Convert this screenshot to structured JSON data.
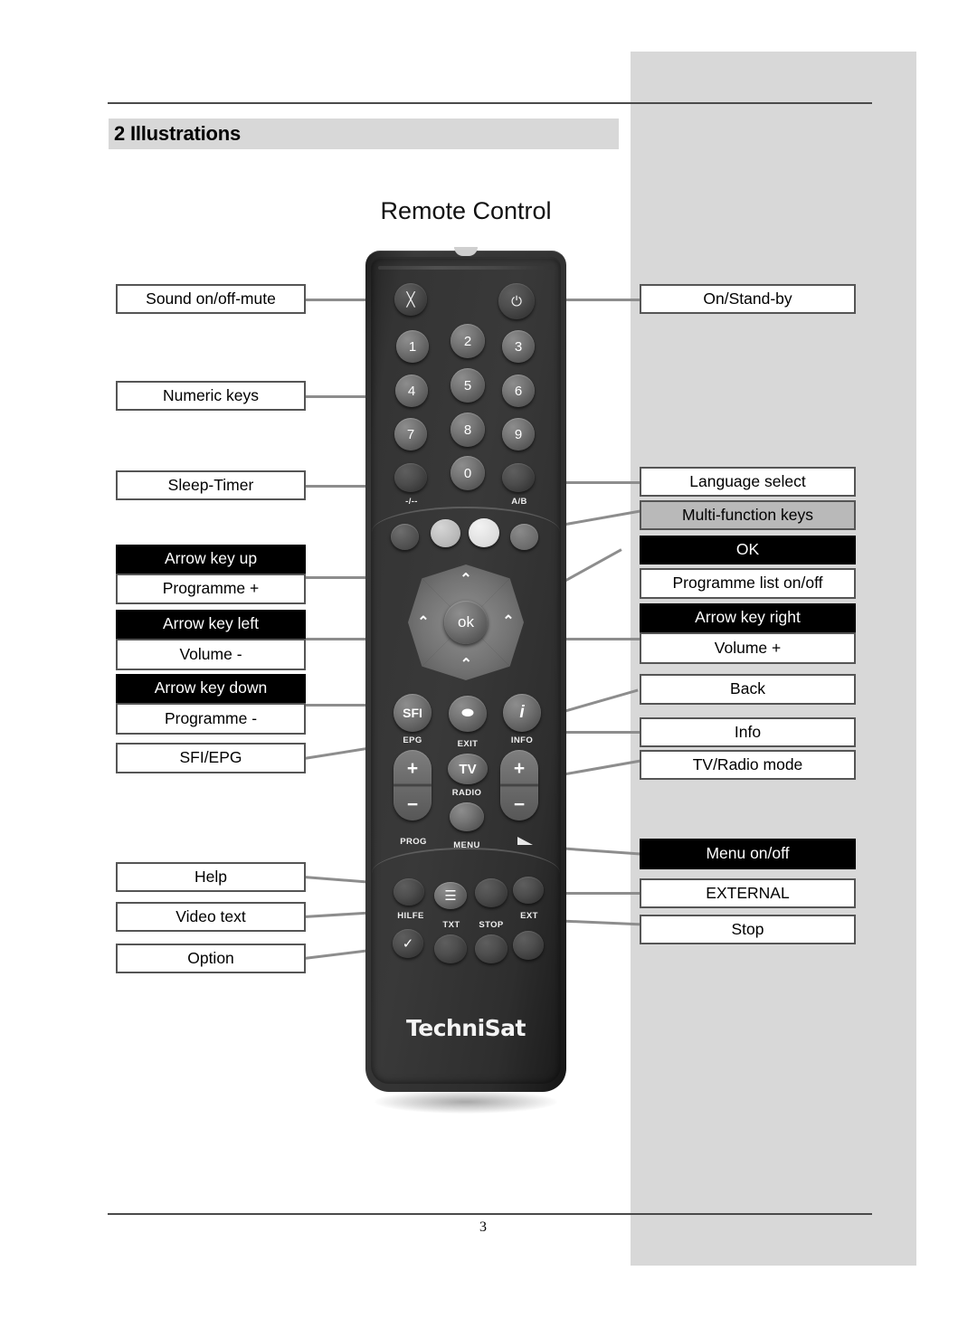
{
  "document": {
    "chapter_title": "2 Illustrations",
    "figure_title": "Remote Control",
    "page_number": "3"
  },
  "callouts": {
    "left": [
      {
        "label": "Sound on/off-mute",
        "style": "white"
      },
      {
        "label": "Numeric keys",
        "style": "white"
      },
      {
        "label": "Sleep-Timer",
        "style": "white"
      },
      {
        "label": "Arrow key up",
        "style": "dark"
      },
      {
        "label": "Programme +",
        "style": "white"
      },
      {
        "label": "Arrow key left",
        "style": "dark"
      },
      {
        "label": "Volume -",
        "style": "white"
      },
      {
        "label": "Arrow key down",
        "style": "dark"
      },
      {
        "label": "Programme -",
        "style": "white"
      },
      {
        "label": "SFI/EPG",
        "style": "white"
      },
      {
        "label": "Help",
        "style": "white"
      },
      {
        "label": "Video text",
        "style": "white"
      },
      {
        "label": "Option",
        "style": "white"
      }
    ],
    "right": [
      {
        "label": "On/Stand-by",
        "style": "white"
      },
      {
        "label": "Language select",
        "style": "white"
      },
      {
        "label": "Multi-function keys",
        "style": "grey"
      },
      {
        "label": "OK",
        "style": "dark"
      },
      {
        "label": "Programme list on/off",
        "style": "white"
      },
      {
        "label": "Arrow key right",
        "style": "dark"
      },
      {
        "label": "Volume +",
        "style": "white"
      },
      {
        "label": "Back",
        "style": "white"
      },
      {
        "label": "Info",
        "style": "white"
      },
      {
        "label": "TV/Radio mode",
        "style": "white"
      },
      {
        "label": "Menu on/off",
        "style": "dark"
      },
      {
        "label": "EXTERNAL",
        "style": "white"
      },
      {
        "label": "Stop",
        "style": "white"
      }
    ]
  },
  "remote": {
    "brand": "TechniSat",
    "keys": {
      "mute_glyph": "╳",
      "power_glyph": "⏻",
      "digits": [
        "1",
        "2",
        "3",
        "4",
        "5",
        "6",
        "7",
        "8",
        "9",
        "0"
      ],
      "minus_slash": "-/--",
      "ab": "A/B",
      "ok": "ok",
      "chevron_up": "⌃",
      "chevron_down": "⌃",
      "chevron_left": "⌃",
      "chevron_right": "⌃",
      "sfi": "SFI",
      "info": "i",
      "tv": "TV",
      "plus": "+",
      "minus": "−",
      "check": "✓",
      "txt_glyph": "≡"
    },
    "legends": {
      "epg": "EPG",
      "exit": "EXIT",
      "info": "INFO",
      "prog": "PROG",
      "radio": "RADIO",
      "menu": "MENU",
      "hilfe": "HILFE",
      "txt": "TXT",
      "stop": "STOP",
      "ext": "EXT",
      "minus_slash": "-/--",
      "ab": "A/B"
    }
  }
}
